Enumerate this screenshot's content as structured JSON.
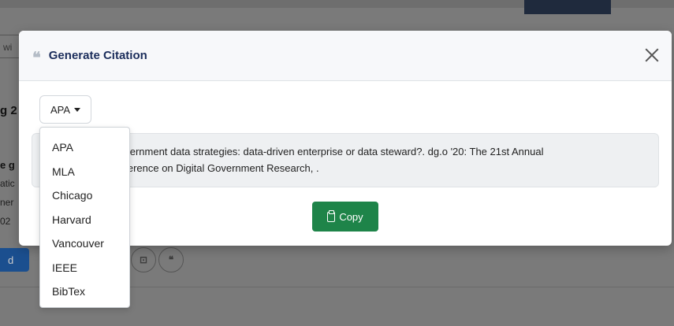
{
  "background": {
    "search_fragment": "wi",
    "heading_fragment": "g 2",
    "bold_fragment": "e g",
    "line_fragments": [
      "atic",
      "ner",
      "02"
    ],
    "read_button_fragment": "d",
    "action_icons": [
      "export-icon",
      "quote-icon"
    ],
    "action_quote_glyph": "❝"
  },
  "modal": {
    "title": "Generate Citation",
    "quote_glyph": "❝",
    "selected_style": "APA",
    "citation_line1": "overnment data strategies: data-driven enterprise or data steward?. dg.o '20: The 21st Annual",
    "citation_line2": "nference on Digital Government Research,    .",
    "copy_label": "Copy"
  },
  "dropdown": {
    "options": [
      "APA",
      "MLA",
      "Chicago",
      "Harvard",
      "Vancouver",
      "IEEE",
      "BibTex"
    ]
  },
  "colors": {
    "title": "#1b2d5b",
    "copy_button": "#1e8449",
    "overlay": "#7a7a7a"
  }
}
